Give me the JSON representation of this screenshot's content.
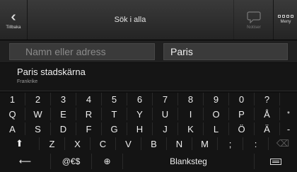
{
  "topbar": {
    "back_label": "Tillbaka",
    "back_icon": "double-chevron-left-icon",
    "title": "Sök i alla",
    "notif_label": "Notiser",
    "menu_label": "Meny",
    "menu_icon": "menu-grid-icon"
  },
  "search": {
    "name_placeholder": "Namn eller adress",
    "city_value": "Paris"
  },
  "results": [
    {
      "title": "Paris stadskärna",
      "subtitle": "Frankrike"
    }
  ],
  "keyboard": {
    "row1": [
      "1",
      "2",
      "3",
      "4",
      "5",
      "6",
      "7",
      "8",
      "9",
      "0",
      "?"
    ],
    "row2": [
      "Q",
      "W",
      "E",
      "R",
      "T",
      "Y",
      "U",
      "I",
      "O",
      "P",
      "Å",
      "*"
    ],
    "row3": [
      "A",
      "S",
      "D",
      "F",
      "G",
      "H",
      "J",
      "K",
      "L",
      "Ö",
      "Ä",
      "-"
    ],
    "row4": [
      "Z",
      "X",
      "C",
      "V",
      "B",
      "N",
      "M",
      ";",
      ":"
    ],
    "shift_glyph": "⬆",
    "backspace_glyph": "⌫",
    "back_arrow_glyph": "⟵",
    "symbols_label": "@€$",
    "globe_glyph": "⊕",
    "space_label": "Blanksteg"
  }
}
